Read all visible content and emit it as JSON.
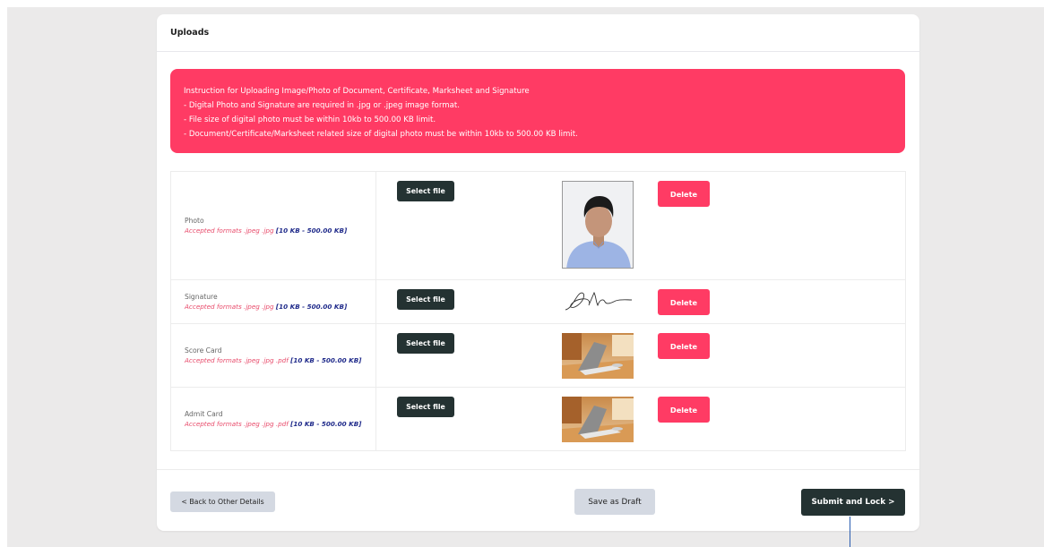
{
  "card": {
    "title": "Uploads"
  },
  "instructions": {
    "heading": "Instruction for Uploading Image/Photo of Document, Certificate, Marksheet and Signature",
    "lines": [
      "- Digital Photo and Signature are required in .jpg or .jpeg image format.",
      "- File size of digital photo must be within 10kb to 500.00 KB limit.",
      "- Document/Certificate/Marksheet related size of digital photo must be within 10kb to 500.00 KB limit."
    ]
  },
  "uploads": [
    {
      "name": "Photo",
      "formats": "Accepted formats .jpeg .jpg ",
      "size_range": "[10 KB - 500.00 KB]",
      "select_label": "Select file",
      "delete_label": "Delete",
      "preview": "passport-photo"
    },
    {
      "name": "Signature",
      "formats": "Accepted formats .jpeg .jpg ",
      "size_range": "[10 KB - 500.00 KB]",
      "select_label": "Select file",
      "delete_label": "Delete",
      "preview": "signature-image"
    },
    {
      "name": "Score Card",
      "formats": "Accepted formats .jpeg .jpg .pdf ",
      "size_range": "[10 KB - 500.00 KB]",
      "select_label": "Select file",
      "delete_label": "Delete",
      "preview": "desk-photo"
    },
    {
      "name": "Admit Card",
      "formats": "Accepted formats .jpeg .jpg .pdf ",
      "size_range": "[10 KB - 500.00 KB]",
      "select_label": "Select file",
      "delete_label": "Delete",
      "preview": "desk-photo"
    }
  ],
  "footer": {
    "back_label": "< Back to Other Details",
    "draft_label": "Save as Draft",
    "submit_label": "Submit and Lock >"
  },
  "colors": {
    "accent_pink": "#ff3b64",
    "dark_button": "#243232",
    "muted_button": "#d4d9e2",
    "size_text": "#1f2a8a"
  }
}
